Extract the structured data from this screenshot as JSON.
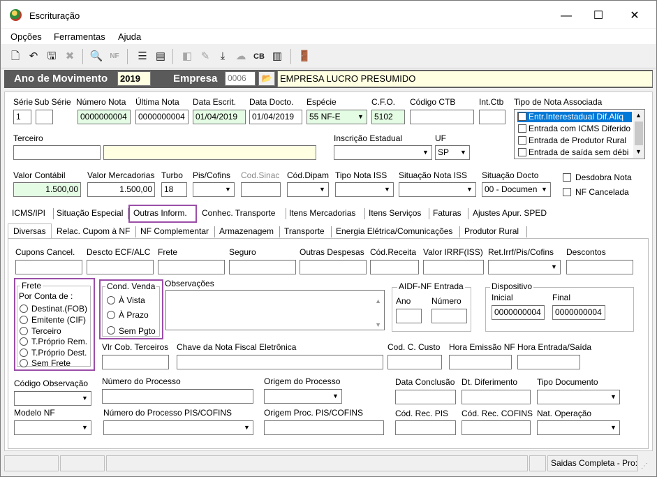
{
  "window": {
    "title": "Escrituração",
    "minimize": "—",
    "maximize": "☐",
    "close": "✕"
  },
  "menu": [
    "Opções",
    "Ferramentas",
    "Ajuda"
  ],
  "toolbar_icons": [
    "new-document-icon",
    "undo-icon",
    "save-icon",
    "delete-icon",
    "print-preview-icon",
    "nfe-icon",
    "tree-icon",
    "export-icon",
    "import-icon",
    "edit-icon",
    "download-icon",
    "cloud-icon",
    "cb-icon",
    "columns-icon",
    "exit-door-icon"
  ],
  "header": {
    "ano_label": "Ano de Movimento",
    "ano": "2019",
    "empresa_label": "Empresa",
    "empresa_code": "0006",
    "empresa_name": "EMPRESA LUCRO PRESUMIDO"
  },
  "row1": {
    "serie_label": "Série",
    "serie": "1",
    "subserie_label": "Sub Série",
    "subserie": "",
    "numero_label": "Número Nota",
    "numero": "0000000004",
    "ultima_label": "Última Nota",
    "ultima": "0000000004",
    "data_escrit_label": "Data Escrit.",
    "data_escrit": "01/04/2019",
    "data_docto_label": "Data Docto.",
    "data_docto": "01/04/2019",
    "especie_label": "Espécie",
    "especie": "55   NF-E",
    "cfo_label": "C.F.O.",
    "cfo": "5102",
    "codctb_label": "Código CTB",
    "codctb": "",
    "intctb_label": "Int.Ctb",
    "intctb": ""
  },
  "tipo_nota": {
    "label": "Tipo de Nota Associada",
    "items": [
      "Entr.Interestadual Dif.Alíq",
      "Entrada com ICMS Diferido",
      "Entrada de Produtor Rural",
      "Entrada de saída sem débi"
    ]
  },
  "row2": {
    "terceiro_label": "Terceiro",
    "terceiro": "",
    "terceiro_nome": "",
    "ie_label": "Inscrição Estadual",
    "ie": "",
    "uf_label": "UF",
    "uf": "SP"
  },
  "row3": {
    "valor_contabil_label": "Valor Contábil",
    "valor_contabil": "1.500,00",
    "valor_merc_label": "Valor Mercadorias",
    "valor_merc": "1.500,00",
    "turbo_label": "Turbo",
    "turbo": "18",
    "piscofins_label": "Pis/Cofins",
    "codsinac_label": "Cod.Sinac",
    "coddipam_label": "Cód.Dipam",
    "tiponotaiss_label": "Tipo Nota ISS",
    "situacaoiss_label": "Situação Nota ISS",
    "situacaodocto_label": "Situação Docto",
    "situacaodocto": "00 - Documen",
    "desdobra_label": "Desdobra Nota",
    "cancelada_label": "NF Cancelada"
  },
  "tabs1": [
    "ICMS/IPI",
    "Situação Especial",
    "Outras Inform.",
    "Conhec. Transporte",
    "Itens Mercadorias",
    "Itens Serviços",
    "Faturas",
    "Ajustes Apur. SPED"
  ],
  "tabs2": [
    "Diversas",
    "Relac. Cupom à NF",
    "NF Complementar",
    "Armazenagem",
    "Transporte",
    "Energia Elétrica/Comunicações",
    "Produtor Rural"
  ],
  "diversas": {
    "cupons_label": "Cupons Cancel.",
    "descto_label": "Descto ECF/ALC",
    "frete_label": "Frete",
    "seguro_label": "Seguro",
    "outras_label": "Outras Despesas",
    "codreceita_label": "Cód.Receita",
    "irrf_label": "Valor IRRF(ISS)",
    "retirrf_label": "Ret.Irrf/Pis/Cofins",
    "descontos_label": "Descontos",
    "frete_group": "Frete",
    "por_conta": "Por Conta de :",
    "frete_options": [
      "Destinat.(FOB)",
      "Emitente (CIF)",
      "Terceiro",
      "T.Próprio Rem.",
      "T.Próprio Dest.",
      "Sem Frete"
    ],
    "venda_group": "Cond. Venda",
    "venda_options": [
      "À Vista",
      "À Prazo",
      "Sem Pgto"
    ],
    "obs_label": "Observações",
    "aidf_group": "AIDF-NF Entrada",
    "ano_label": "Ano",
    "numero_label": "Número",
    "disp_group": "Dispositivo",
    "inicial_label": "Inicial",
    "inicial": "0000000004",
    "final_label": "Final",
    "final": "0000000004",
    "vlrcob_label": "Vlr Cob. Terceiros",
    "chave_label": "Chave da Nota Fiscal Eletrônica",
    "codcusto_label": "Cod. C. Custo",
    "horaemissao_label": "Hora Emissão NF",
    "horaentrada_label": "Hora Entrada/Saída",
    "codobs_label": "Código Observação",
    "numproc_label": "Número do Processo",
    "origproc_label": "Origem do Processo",
    "dataconc_label": "Data Conclusão",
    "dtdif_label": "Dt. Diferimento",
    "tipodoc_label": "Tipo Documento",
    "modelonf_label": "Modelo NF",
    "numprocpis_label": "Número do Processo PIS/COFINS",
    "origprocpis_label": "Origem Proc. PIS/COFINS",
    "codrecpis_label": "Cód. Rec. PIS",
    "codreccofins_label": "Cód. Rec. COFINS",
    "natop_label": "Nat. Operação"
  },
  "status": {
    "text": "Saidas Completa - Pro:"
  },
  "colors": {
    "highlight": "#9b4ea8",
    "green_field": "#e4fbe4",
    "yellow_field": "#ffffe1",
    "year_bar": "#5a5a5a"
  }
}
